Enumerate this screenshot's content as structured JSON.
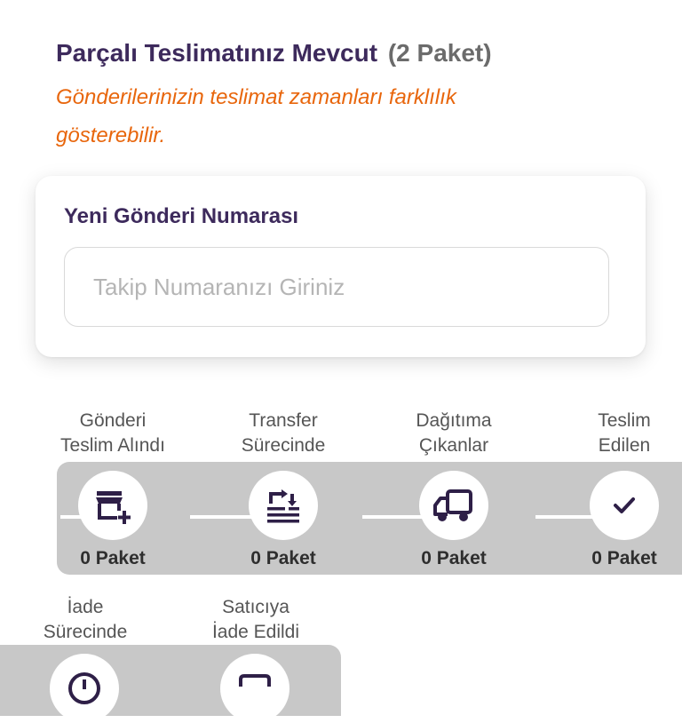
{
  "header": {
    "title": "Parçalı Teslimatınız Mevcut",
    "package_count": "(2 Paket)",
    "subtitle": "Gönderilerinizin teslimat zamanları farklılık gösterebilir."
  },
  "new_shipment": {
    "label": "Yeni Gönderi Numarası",
    "input_value": "",
    "placeholder": "Takip Numaranızı Giriniz"
  },
  "statuses": [
    {
      "label_line1": "Gönderi",
      "label_line2": "Teslim Alındı",
      "count": "0 Paket",
      "icon": "store-add-icon"
    },
    {
      "label_line1": "Transfer",
      "label_line2": "Sürecinde",
      "count": "0 Paket",
      "icon": "transfer-icon"
    },
    {
      "label_line1": "Dağıtıma",
      "label_line2": "Çıkanlar",
      "count": "0 Paket",
      "icon": "truck-icon"
    },
    {
      "label_line1": "Teslim",
      "label_line2": "Edilen",
      "count": "0 Paket",
      "icon": "check-icon"
    },
    {
      "label_line1": "İade",
      "label_line2": "Sürecinde",
      "count": "",
      "icon": "return-clock-icon"
    },
    {
      "label_line1": "Satıcıya",
      "label_line2": "İade Edildi",
      "count": "",
      "icon": "returned-box-icon"
    }
  ],
  "colors": {
    "title": "#3d2a5c",
    "accent": "#e8660c",
    "band": "#c8c8c8",
    "icon": "#2e1f47"
  }
}
